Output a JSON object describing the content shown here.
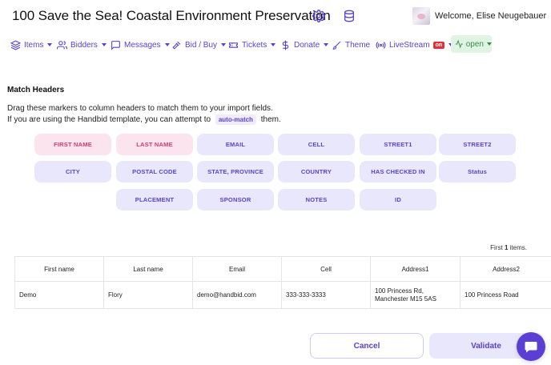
{
  "header": {
    "title": "100 Save the Sea! Coastal Environment Preservation",
    "welcome": "Welcome, Elise Neugebauer",
    "icons": [
      "gear-icon",
      "database-icon",
      "chevron-down-icon"
    ]
  },
  "nav": {
    "items": [
      {
        "label": "Items",
        "icon": "layers-icon"
      },
      {
        "label": "Bidders",
        "icon": "users-icon"
      },
      {
        "label": "Messages",
        "icon": "message-icon"
      },
      {
        "label": "Bid / Buy",
        "icon": "gavel-icon"
      },
      {
        "label": "Tickets",
        "icon": "ticket-icon"
      },
      {
        "label": "Donate",
        "icon": "dollar-icon"
      },
      {
        "label": "Theme",
        "icon": "brush-icon"
      },
      {
        "label": "LiveStream",
        "icon": "broadcast-icon",
        "badge": "on"
      }
    ],
    "status": "open"
  },
  "match": {
    "title": "Match Headers",
    "instruction1": "Drag these markers to column headers to match them to your import fields.",
    "instruction2_pre": "If you are using the Handbid template, you can attempt to",
    "automatch": "auto-match",
    "instruction2_post": "them.",
    "markers": [
      {
        "label": "FIRST NAME",
        "matched": true
      },
      {
        "label": "LAST NAME",
        "matched": true
      },
      {
        "label": "EMAIL",
        "matched": false
      },
      {
        "label": "CELL",
        "matched": false
      },
      {
        "label": "STREET1",
        "matched": false
      },
      {
        "label": "STREET2",
        "matched": false
      },
      {
        "label": "CITY",
        "matched": false
      },
      {
        "label": "POSTAL CODE",
        "matched": false
      },
      {
        "label": "STATE, PROVINCE",
        "matched": false
      },
      {
        "label": "COUNTRY",
        "matched": false
      },
      {
        "label": "HAS CHECKED IN",
        "matched": false
      },
      {
        "label": "Status",
        "matched": false
      },
      {
        "label": "PLACEMENT",
        "matched": false
      },
      {
        "label": "SPONSOR",
        "matched": false
      },
      {
        "label": "NOTES",
        "matched": false
      },
      {
        "label": "ID",
        "matched": false
      }
    ]
  },
  "table": {
    "count_pre": "First",
    "count_num": "1",
    "count_post": "items.",
    "columns": [
      "First name",
      "Last name",
      "Email",
      "Cell",
      "Address1",
      "Address2"
    ],
    "rows": [
      [
        "Demo",
        "Flory",
        "demo@handbid.com",
        "333-333-3333",
        "100 Princess Rd, Manchester M15 5AS",
        "100 Princess Road"
      ]
    ]
  },
  "actions": {
    "cancel": "Cancel",
    "validate": "Validate"
  },
  "colors": {
    "accent": "#5b3fd4",
    "marker_bg": "#e9e7fb",
    "marker_matched_bg": "#fbe4ee",
    "marker_matched_text": "#d03b6d",
    "open_bg": "#dff4e2",
    "live_badge": "#e0313a"
  }
}
